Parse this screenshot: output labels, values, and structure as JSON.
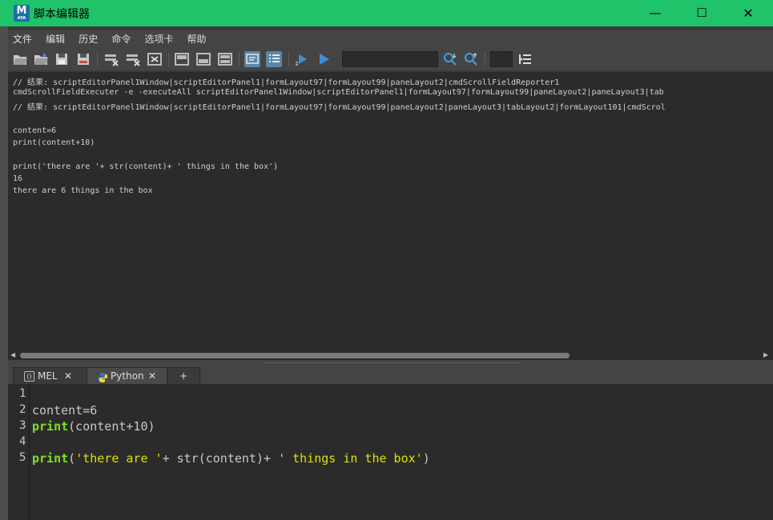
{
  "window": {
    "title": "脚本编辑器",
    "app_icon_letter": "M",
    "app_icon_sub": "AYA",
    "minimize": "—",
    "maximize": "☐",
    "close": "✕"
  },
  "menu": [
    "文件",
    "编辑",
    "历史",
    "命令",
    "选项卡",
    "帮助"
  ],
  "output_lines": [
    "// 结果: scriptEditorPanel1Window|scriptEditorPanel1|formLayout97|formLayout99|paneLayout2|cmdScrollFieldReporter1",
    "cmdScrollFieldExecuter -e -executeAll scriptEditorPanel1Window|scriptEditorPanel1|formLayout97|formLayout99|paneLayout2|paneLayout3|tab",
    "// 结果: scriptEditorPanel1Window|scriptEditorPanel1|formLayout97|formLayout99|paneLayout2|paneLayout3|tabLayout2|formLayout101|cmdScrol",
    "",
    "content=6",
    "print(content+10)",
    "",
    "print('there are '+ str(content)+ ' things in the box')",
    "16",
    "there are 6 things in the box"
  ],
  "tabs": {
    "mel": "MEL",
    "python": "Python",
    "add": "+",
    "close": "✕"
  },
  "editor": {
    "line_numbers": [
      "1",
      "2",
      "3",
      "4",
      "5"
    ],
    "line2": "content=6",
    "line3_kw": "print",
    "line3_rest": "(content+10)",
    "line5_kw": "print",
    "line5_p1": "(",
    "line5_s1": "'there are '",
    "line5_p2": "+ str(content)+ ",
    "line5_s2": "' things in the box'",
    "line5_p3": ")"
  },
  "colors": {
    "titlebar": "#1fc36a",
    "keyword": "#7ee21e",
    "string": "#e0e000",
    "active_tool": "#5a86a8"
  },
  "icons": [
    "open-script-icon",
    "source-script-icon",
    "save-script-icon",
    "save-script-to-shelf-icon",
    "clear-history-icon",
    "clear-input-icon",
    "clear-all-icon",
    "show-history-only-icon",
    "show-input-only-icon",
    "show-both-icon",
    "echo-all-commands-icon",
    "line-numbers-icon",
    "execute-selected-icon",
    "execute-all-icon",
    "search-next-icon",
    "search-prev-icon",
    "goto-line-icon"
  ]
}
